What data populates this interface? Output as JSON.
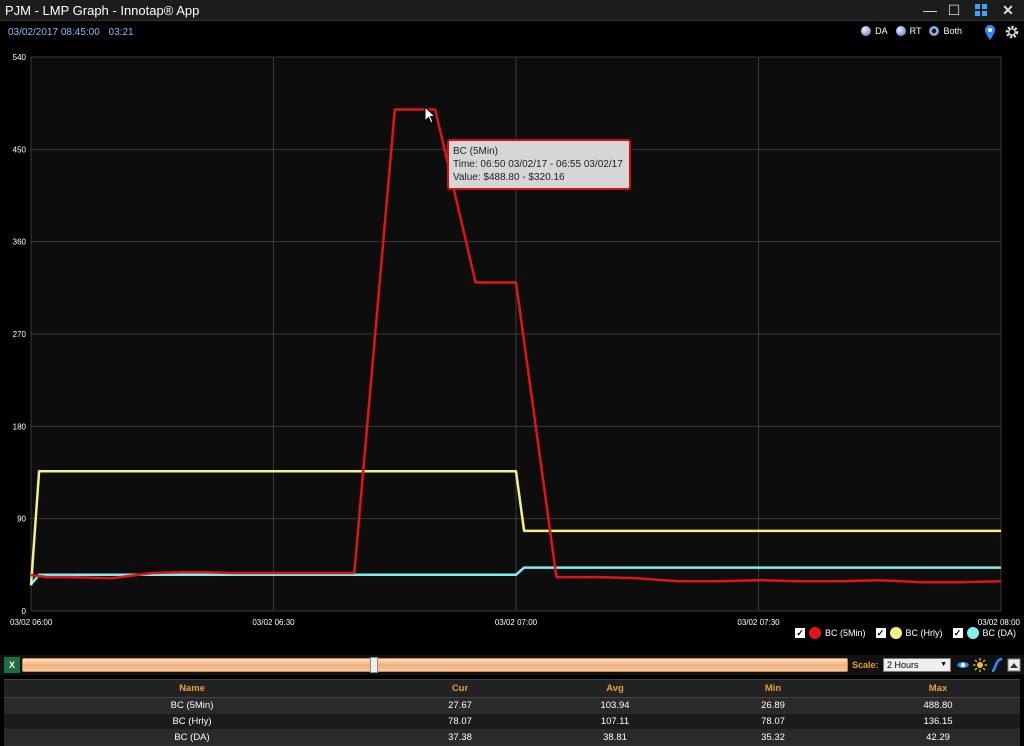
{
  "window": {
    "title": "PJM - LMP Graph - Innotap® App"
  },
  "status": {
    "datetime": "03/02/2017 08:45:00",
    "countdown": "03:21"
  },
  "radios": [
    {
      "label": "DA",
      "selected": false
    },
    {
      "label": "RT",
      "selected": false
    },
    {
      "label": "Both",
      "selected": true
    }
  ],
  "tooltip": {
    "name": "BC (5Min)",
    "time": "Time: 06:50 03/02/17 - 06:55 03/02/17",
    "value": "Value: $488.80 - $320.16"
  },
  "controls": {
    "scale_label": "Scale:",
    "scale_value": "2 Hours"
  },
  "table": {
    "headers": [
      "Name",
      "Cur",
      "Avg",
      "Min",
      "Max"
    ],
    "rows": [
      [
        "BC (5Min)",
        "27.67",
        "103.94",
        "26.89",
        "488.80"
      ],
      [
        "BC (Hrly)",
        "78.07",
        "107.11",
        "78.07",
        "136.15"
      ],
      [
        "BC (DA)",
        "37.38",
        "38.81",
        "35.32",
        "42.29"
      ]
    ]
  },
  "chart_data": {
    "type": "line",
    "ylim": [
      0,
      540
    ],
    "yticks": [
      "0",
      "90",
      "180",
      "270",
      "360",
      "450",
      "540"
    ],
    "xlim": [
      0,
      120
    ],
    "xticks": [
      "03/02 06:00",
      "03/02 06:30",
      "03/02 07:00",
      "03/02 07:30",
      "03/02 08:00"
    ],
    "grid": true,
    "legend_position": "bottom-right",
    "series": [
      {
        "name": "BC (5Min)",
        "color": "#e0141a",
        "checked": true,
        "points": [
          [
            0,
            35
          ],
          [
            2,
            33
          ],
          [
            5,
            33
          ],
          [
            10,
            32
          ],
          [
            15,
            37
          ],
          [
            20,
            38
          ],
          [
            25,
            37
          ],
          [
            30,
            37
          ],
          [
            35,
            37
          ],
          [
            40,
            37
          ],
          [
            45,
            488.8
          ],
          [
            50,
            488.8
          ],
          [
            55,
            320.16
          ],
          [
            60,
            320.16
          ],
          [
            65,
            33
          ],
          [
            70,
            33
          ],
          [
            75,
            32
          ],
          [
            80,
            29
          ],
          [
            85,
            29
          ],
          [
            90,
            30
          ],
          [
            95,
            29
          ],
          [
            100,
            29
          ],
          [
            105,
            30
          ],
          [
            110,
            28
          ],
          [
            115,
            28
          ],
          [
            120,
            29
          ]
        ]
      },
      {
        "name": "BC (Hrly)",
        "color": "#f3f08a",
        "checked": true,
        "points": [
          [
            0,
            25
          ],
          [
            1,
            136.15
          ],
          [
            60,
            136.15
          ],
          [
            61,
            78.07
          ],
          [
            120,
            78.07
          ]
        ]
      },
      {
        "name": "BC (DA)",
        "color": "#7ff0f0",
        "checked": true,
        "points": [
          [
            0,
            26
          ],
          [
            1,
            35.32
          ],
          [
            60,
            35.32
          ],
          [
            61,
            42.29
          ],
          [
            120,
            42.29
          ]
        ]
      }
    ]
  }
}
